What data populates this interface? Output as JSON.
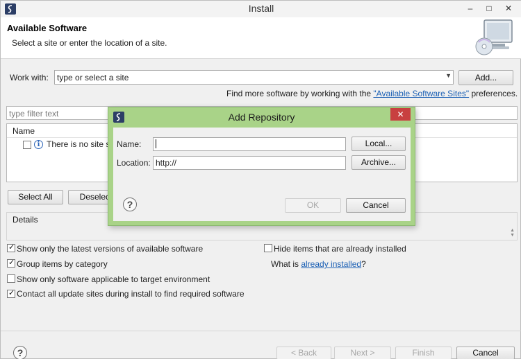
{
  "window": {
    "title": "Install",
    "minimize": "‒",
    "maximize": "□",
    "close": "✕"
  },
  "header": {
    "title": "Available Software",
    "subtitle": "Select a site or enter the location of a site."
  },
  "work_with": {
    "label": "Work with:",
    "value": "type or select a site",
    "add_button": "Add...",
    "find_more_prefix": "Find more software by working with the ",
    "find_more_link": "\"Available Software Sites\"",
    "find_more_suffix": " preferences."
  },
  "filter": {
    "placeholder": "type filter text"
  },
  "table": {
    "column": "Name",
    "row_text": "There is no site s"
  },
  "selection_buttons": {
    "select_all": "Select All",
    "deselect_all": "Deselect"
  },
  "details": {
    "title": "Details"
  },
  "options": {
    "show_latest": {
      "label": "Show only the latest versions of available software",
      "checked": true
    },
    "group_by_category": {
      "label": "Group items by category",
      "checked": true
    },
    "applicable_only": {
      "label": "Show only software applicable to target environment",
      "checked": false
    },
    "contact_update_sites": {
      "label": "Contact all update sites during install to find required software",
      "checked": true
    },
    "hide_installed": {
      "label": "Hide items that are already installed",
      "checked": false
    },
    "what_is_prefix": "What is ",
    "what_is_link": "already installed",
    "what_is_suffix": "?"
  },
  "footer": {
    "help": "?",
    "back": "< Back",
    "next": "Next >",
    "finish": "Finish",
    "cancel": "Cancel"
  },
  "add_repository": {
    "title": "Add Repository",
    "close": "✕",
    "name_label": "Name:",
    "name_value": "",
    "local_button": "Local...",
    "location_label": "Location:",
    "location_value": "http://",
    "archive_button": "Archive...",
    "help": "?",
    "ok_button": "OK",
    "cancel_button": "Cancel"
  }
}
